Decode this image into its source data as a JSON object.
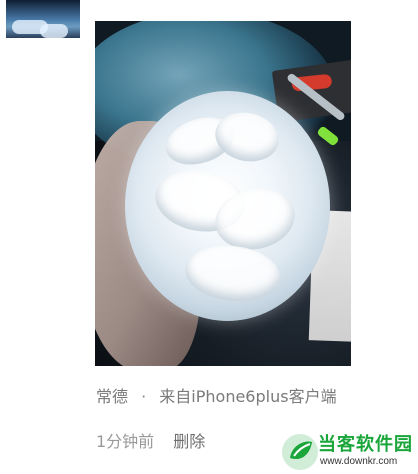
{
  "post": {
    "author": "常德",
    "separator": "·",
    "source": "来自iPhone6plus客户端",
    "time": "1分钟前",
    "delete_label": "删除"
  },
  "watermark": {
    "title": "当客软件园",
    "url": "www.downkr.com",
    "logo_color": "#1aa63a"
  },
  "icons": {
    "avatar": "avatar-sky-image",
    "photo": "white-fabric-flower-photo",
    "watermark_logo": "green-leaf-logo-icon"
  }
}
